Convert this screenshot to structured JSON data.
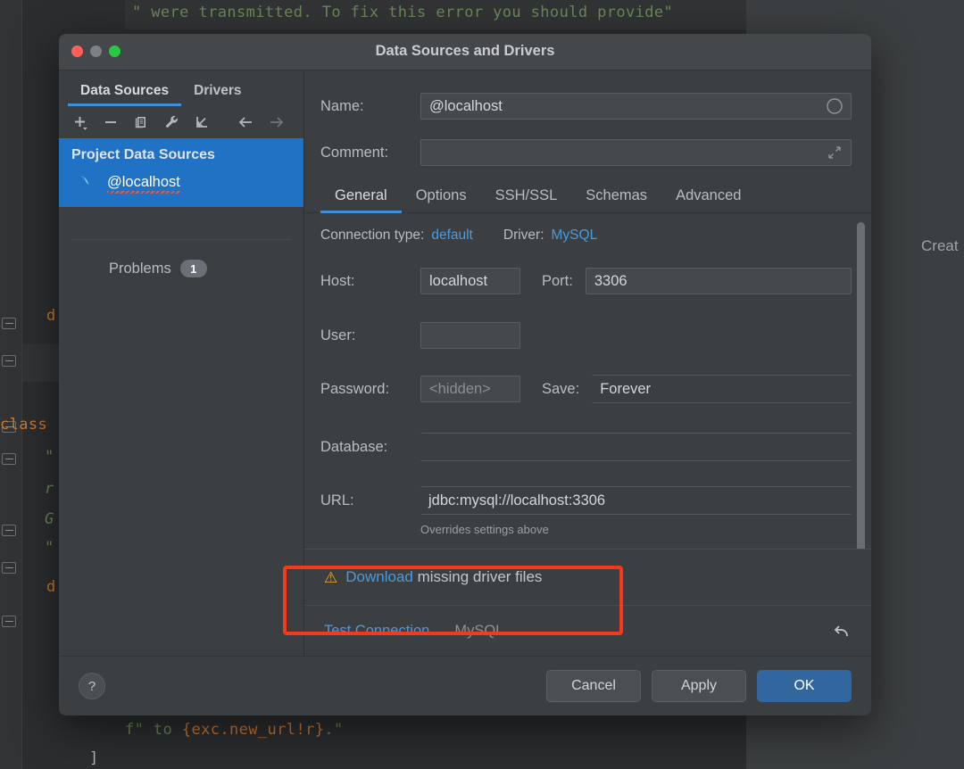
{
  "background": {
    "code_lines": [
      {
        "text": "\" were transmitted. To fix this error you should provide\"",
        "kind": "string"
      },
      {
        "text": "d",
        "kind": "keyword"
      },
      {
        "text": "class",
        "kind": "keyword"
      },
      {
        "text": "\"",
        "kind": "string"
      },
      {
        "text": "r",
        "kind": "string-italic"
      },
      {
        "text": "G",
        "kind": "string-italic"
      },
      {
        "text": "\"",
        "kind": "string"
      },
      {
        "text": "d",
        "kind": "keyword"
      }
    ],
    "bottom_line_parts": [
      {
        "text": "f\"",
        "kind": "string"
      },
      {
        "text": " to ",
        "kind": "string"
      },
      {
        "text": "{exc.new_url!r}",
        "kind": "keyword"
      },
      {
        "text": ".\"",
        "kind": "string"
      }
    ],
    "closing_bracket": "]",
    "right_panel_text": "Creat"
  },
  "dialog": {
    "title": "Data Sources and Drivers",
    "window_controls": {
      "close": "close-button",
      "minimize": "minimize-button",
      "zoom": "zoom-button"
    }
  },
  "sidebar": {
    "tabs": [
      {
        "label": "Data Sources",
        "active": true
      },
      {
        "label": "Drivers",
        "active": false
      }
    ],
    "toolbar": [
      {
        "name": "add-button",
        "glyph": "plus",
        "disabled": false
      },
      {
        "name": "remove-button",
        "glyph": "minus",
        "disabled": false
      },
      {
        "name": "duplicate-button",
        "glyph": "copy",
        "disabled": false
      },
      {
        "name": "properties-button",
        "glyph": "wrench",
        "disabled": false
      },
      {
        "name": "import-button",
        "glyph": "import-arrow",
        "disabled": false
      },
      {
        "name": "back-button",
        "glyph": "arrow-left",
        "disabled": false
      },
      {
        "name": "forward-button",
        "glyph": "arrow-right",
        "disabled": true
      }
    ],
    "group_title": "Project Data Sources",
    "items": [
      {
        "label": "@localhost",
        "icon": "mysql-dolphin-icon",
        "selected": true,
        "has_error": true
      }
    ],
    "problems": {
      "label": "Problems",
      "count": "1"
    }
  },
  "settings": {
    "name": {
      "label": "Name:",
      "value": "@localhost",
      "icon": "circle-icon"
    },
    "comment": {
      "label": "Comment:",
      "value": "",
      "placeholder": "",
      "icon": "expand-icon"
    },
    "tabs": [
      {
        "label": "General",
        "active": true
      },
      {
        "label": "Options",
        "active": false
      },
      {
        "label": "SSH/SSL",
        "active": false
      },
      {
        "label": "Schemas",
        "active": false
      },
      {
        "label": "Advanced",
        "active": false
      }
    ],
    "connection_type": {
      "label": "Connection type:",
      "value": "default"
    },
    "driver": {
      "label": "Driver:",
      "value": "MySQL"
    },
    "host": {
      "label": "Host:",
      "value": "localhost"
    },
    "port": {
      "label": "Port:",
      "value": "3306"
    },
    "user": {
      "label": "User:",
      "value": ""
    },
    "password": {
      "label": "Password:",
      "value": "",
      "placeholder": "<hidden>"
    },
    "save": {
      "label": "Save:",
      "value": "Forever"
    },
    "database": {
      "label": "Database:",
      "value": ""
    },
    "url": {
      "label": "URL:",
      "value": "jdbc:mysql://localhost:3306",
      "hint": "Overrides settings above"
    },
    "driver_notice": {
      "warning_icon": "warning-triangle-icon",
      "link_text": "Download",
      "rest_text": " missing driver files"
    },
    "status": {
      "test_connection": "Test Connection",
      "driver_name": "MySQL",
      "revert_icon": "revert-arrow-icon"
    }
  },
  "footer": {
    "help": "?",
    "cancel": "Cancel",
    "apply": "Apply",
    "ok": "OK"
  },
  "colors": {
    "accent_blue": "#3d90d9",
    "link_blue": "#4a9ae0",
    "selection_blue": "#1f72c4",
    "primary_button": "#31679e",
    "warning_orange": "#f0a732",
    "annotation_red": "#f5391a",
    "code_string_green": "#6a8759",
    "code_keyword_orange": "#cc7832"
  }
}
